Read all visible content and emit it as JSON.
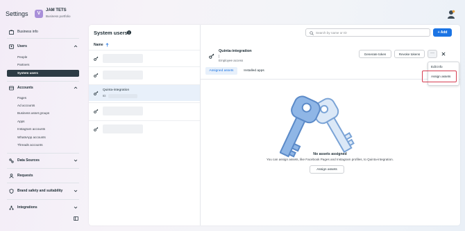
{
  "app": {
    "title": "Settings",
    "portfolio_initial": "V",
    "portfolio_name": "JAM TETS",
    "portfolio_subtitle": "Business portfolio"
  },
  "sidebar": {
    "business_info": "Business info",
    "users": "Users",
    "users_items": [
      "People",
      "Partners",
      "System users"
    ],
    "accounts": "Accounts",
    "accounts_items": [
      "Pages",
      "Ad accounts",
      "Business asset groups",
      "Apps",
      "Instagram accounts",
      "WhatsApp accounts",
      "Threads accounts"
    ],
    "data_sources": "Data Sources",
    "requests": "Requests",
    "brand_safety": "Brand safety and suitability",
    "integrations": "Integrations"
  },
  "main": {
    "title": "System users",
    "search_placeholder": "Search by name or ID",
    "add_label": "+ Add",
    "name_header": "Name",
    "selected_user_name": "Quinta-integration",
    "selected_user_id": "ID:"
  },
  "detail": {
    "name": "Quinta-integration",
    "role": "Employee access",
    "generate_token": "Generate token",
    "revoke_tokens": "Revoke tokens",
    "more_label": "···",
    "tabs": [
      "Assigned assets",
      "Installed apps"
    ],
    "menu": [
      "Edit info",
      "Assign assets"
    ],
    "empty_title": "No assets assigned",
    "empty_description": "You can assign assets, like Facebook Pages and Instagram profiles, to Quinta-integration.",
    "assign_button": "Assign assets"
  },
  "colors": {
    "accent": "#1b74e4",
    "active_nav": "#2d3b45",
    "highlight_border": "#d63b4f",
    "key_blue": "#8fb6e6"
  }
}
